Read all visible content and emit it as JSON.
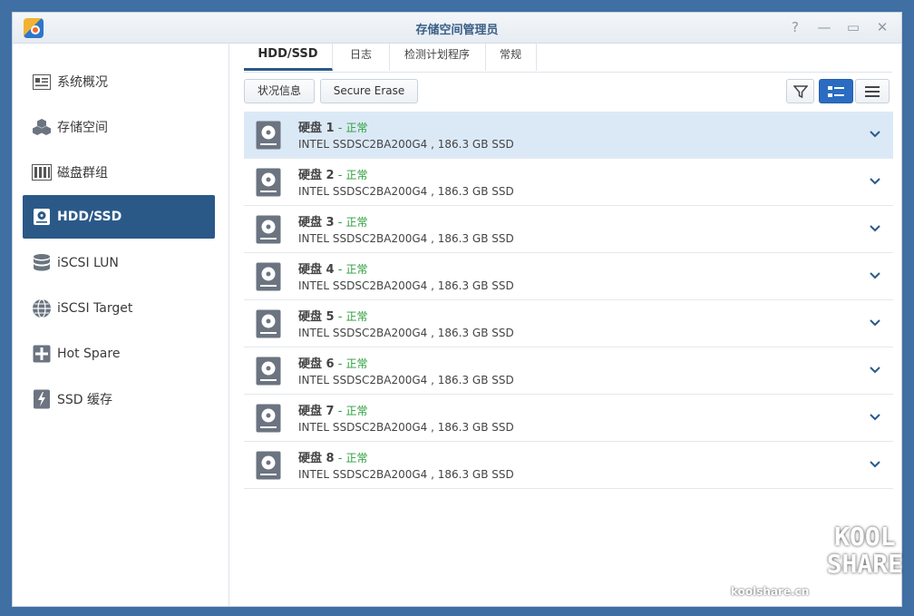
{
  "window": {
    "title": "存储空间管理员",
    "controls": {
      "help": "?",
      "minimize": "—",
      "maximize": "▭",
      "close": "✕"
    }
  },
  "sidebar": {
    "items": [
      {
        "label": "系统概况",
        "icon": "overview-icon"
      },
      {
        "label": "存储空间",
        "icon": "storage-cubes-icon"
      },
      {
        "label": "磁盘群组",
        "icon": "disk-group-icon"
      },
      {
        "label": "HDD/SSD",
        "icon": "hdd-icon",
        "active": true
      },
      {
        "label": "iSCSI LUN",
        "icon": "database-icon"
      },
      {
        "label": "iSCSI Target",
        "icon": "globe-icon"
      },
      {
        "label": "Hot Spare",
        "icon": "hot-spare-icon"
      },
      {
        "label": "SSD 缓存",
        "icon": "ssd-cache-icon"
      }
    ]
  },
  "tabs": [
    {
      "label": "HDD/SSD",
      "active": true
    },
    {
      "label": "日志"
    },
    {
      "label": "检测计划程序"
    },
    {
      "label": "常规"
    }
  ],
  "toolbar": {
    "status_label": "状况信息",
    "secure_erase_label": "Secure Erase",
    "filter_icon": "filter-icon",
    "view_detail_icon": "list-detail-icon",
    "view_list_icon": "list-icon"
  },
  "disks": [
    {
      "name": "硬盘 1",
      "sep": " - ",
      "status": "正常",
      "desc": "INTEL SSDSC2BA200G4 , 186.3 GB SSD"
    },
    {
      "name": "硬盘 2",
      "sep": " - ",
      "status": "正常",
      "desc": "INTEL SSDSC2BA200G4 , 186.3 GB SSD"
    },
    {
      "name": "硬盘 3",
      "sep": " - ",
      "status": "正常",
      "desc": "INTEL SSDSC2BA200G4 , 186.3 GB SSD"
    },
    {
      "name": "硬盘 4",
      "sep": " - ",
      "status": "正常",
      "desc": "INTEL SSDSC2BA200G4 , 186.3 GB SSD"
    },
    {
      "name": "硬盘 5",
      "sep": " - ",
      "status": "正常",
      "desc": "INTEL SSDSC2BA200G4 , 186.3 GB SSD"
    },
    {
      "name": "硬盘 6",
      "sep": " - ",
      "status": "正常",
      "desc": "INTEL SSDSC2BA200G4 , 186.3 GB SSD"
    },
    {
      "name": "硬盘 7",
      "sep": " - ",
      "status": "正常",
      "desc": "INTEL SSDSC2BA200G4 , 186.3 GB SSD"
    },
    {
      "name": "硬盘 8",
      "sep": " - ",
      "status": "正常",
      "desc": "INTEL SSDSC2BA200G4 , 186.3 GB SSD"
    }
  ],
  "watermark": {
    "logo_top": "KOOL",
    "logo_bottom": "SHARE",
    "site": "koolshare.cn"
  },
  "colors": {
    "accent": "#2a5988",
    "status_ok": "#2a9d3a",
    "selected_row": "#dbe9f7"
  }
}
